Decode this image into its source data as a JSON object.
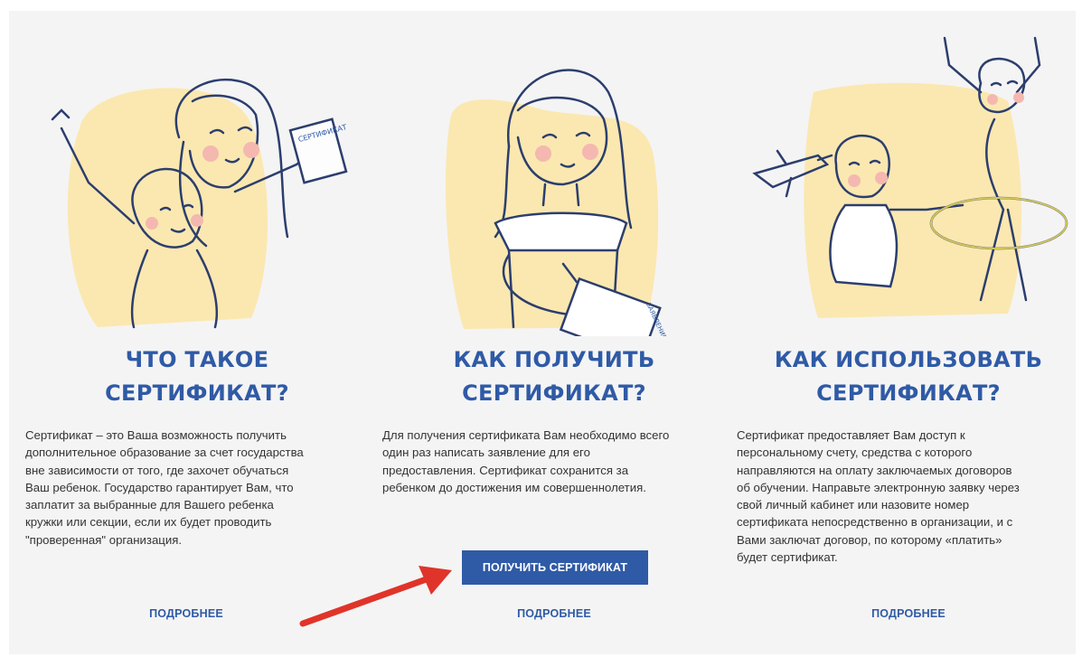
{
  "colors": {
    "accent": "#2f5aa6",
    "panel_bg": "#f4f4f4",
    "illustration_blob": "#fbe8b0",
    "arrow": "#e0342a"
  },
  "columns": [
    {
      "heading": "ЧТО ТАКОЕ СЕРТИФИКАТ?",
      "heading_lines": [
        "ЧТО ТАКОЕ",
        "СЕРТИФИКАТ?"
      ],
      "text_lines": [
        "Сертификат – это Ваша возможность получить",
        "дополнительное образование за счет государства",
        "вне зависимости от того, где захочет обучаться",
        "Ваш ребенок. Государство гарантирует Вам, что",
        "заплатит за выбранные для Вашего ребенка",
        "кружки или секции, если их будет проводить",
        "\"проверенная\" организация."
      ],
      "illustration_label": "СЕРТИФИКАТ",
      "more_label": "ПОДРОБНЕЕ"
    },
    {
      "heading": "КАК ПОЛУЧИТЬ СЕРТИФИКАТ?",
      "heading_lines": [
        "КАК ПОЛУЧИТЬ",
        "СЕРТИФИКАТ?"
      ],
      "text_lines": [
        "Для получения сертификата Вам необходимо всего",
        "один раз написать заявление для его",
        "предоставления. Сертификат сохранится за",
        "ребенком до достижения им совершеннолетия."
      ],
      "illustration_label": "ЗАЯВЛЕНИЕ",
      "button_label": "ПОЛУЧИТЬ СЕРТИФИКАТ",
      "more_label": "ПОДРОБНЕЕ"
    },
    {
      "heading": "КАК ИСПОЛЬЗОВАТЬ СЕРТИФИКАТ?",
      "heading_lines": [
        "КАК ИСПОЛЬЗОВАТЬ",
        "СЕРТИФИКАТ?"
      ],
      "text_lines": [
        "Сертификат предоставляет Вам доступ к",
        "персональному счету, средства с которого",
        "направляются на оплату заключаемых договоров",
        "об обучении. Направьте электронную заявку через",
        "свой личный кабинет или назовите номер",
        "сертификата непосредственно в организации, и с",
        "Вами заключат договор, по которому «платить»",
        "будет сертификат."
      ],
      "more_label": "ПОДРОБНЕЕ"
    }
  ]
}
